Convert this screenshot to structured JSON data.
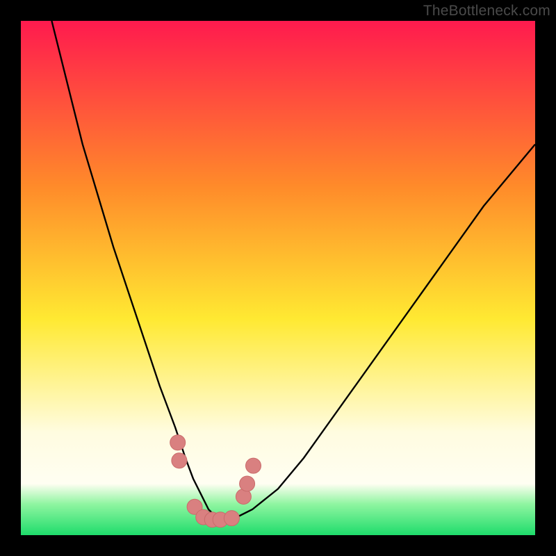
{
  "watermark": "TheBottleneck.com",
  "colors": {
    "gradient_top": "#ff1a4e",
    "gradient_mid_upper": "#ff8a2a",
    "gradient_mid": "#ffe932",
    "gradient_lower_yellow": "#fffce0",
    "gradient_green_light": "#8ef5a0",
    "gradient_green": "#1edc6b",
    "curve": "#000000",
    "marker_fill": "#d98080",
    "marker_stroke": "#c96b6b"
  },
  "chart_data": {
    "type": "line",
    "title": "",
    "xlabel": "",
    "ylabel": "",
    "xlim": [
      0,
      100
    ],
    "ylim": [
      0,
      100
    ],
    "note": "No axis ticks or numeric labels are shown. x/y values are proportional estimates (0-100) read from pixel positions.",
    "series": [
      {
        "name": "bottleneck-curve",
        "x": [
          6,
          8,
          10,
          12,
          15,
          18,
          21,
          24,
          27,
          30,
          32,
          33.5,
          35,
          36.5,
          38,
          40,
          42,
          45,
          50,
          55,
          60,
          65,
          70,
          75,
          80,
          85,
          90,
          95,
          100
        ],
        "y": [
          100,
          92,
          84,
          76,
          66,
          56,
          47,
          38,
          29,
          21,
          15,
          11,
          8,
          5,
          3.5,
          3,
          3.5,
          5,
          9,
          15,
          22,
          29,
          36,
          43,
          50,
          57,
          64,
          70,
          76
        ]
      },
      {
        "name": "highlight-markers",
        "x": [
          30.5,
          30.8,
          33.8,
          35.5,
          37.2,
          38.8,
          41,
          43.3,
          44,
          45.2
        ],
        "y": [
          18,
          14.5,
          5.5,
          3.5,
          3,
          3,
          3.3,
          7.5,
          10,
          13.5
        ]
      }
    ]
  }
}
